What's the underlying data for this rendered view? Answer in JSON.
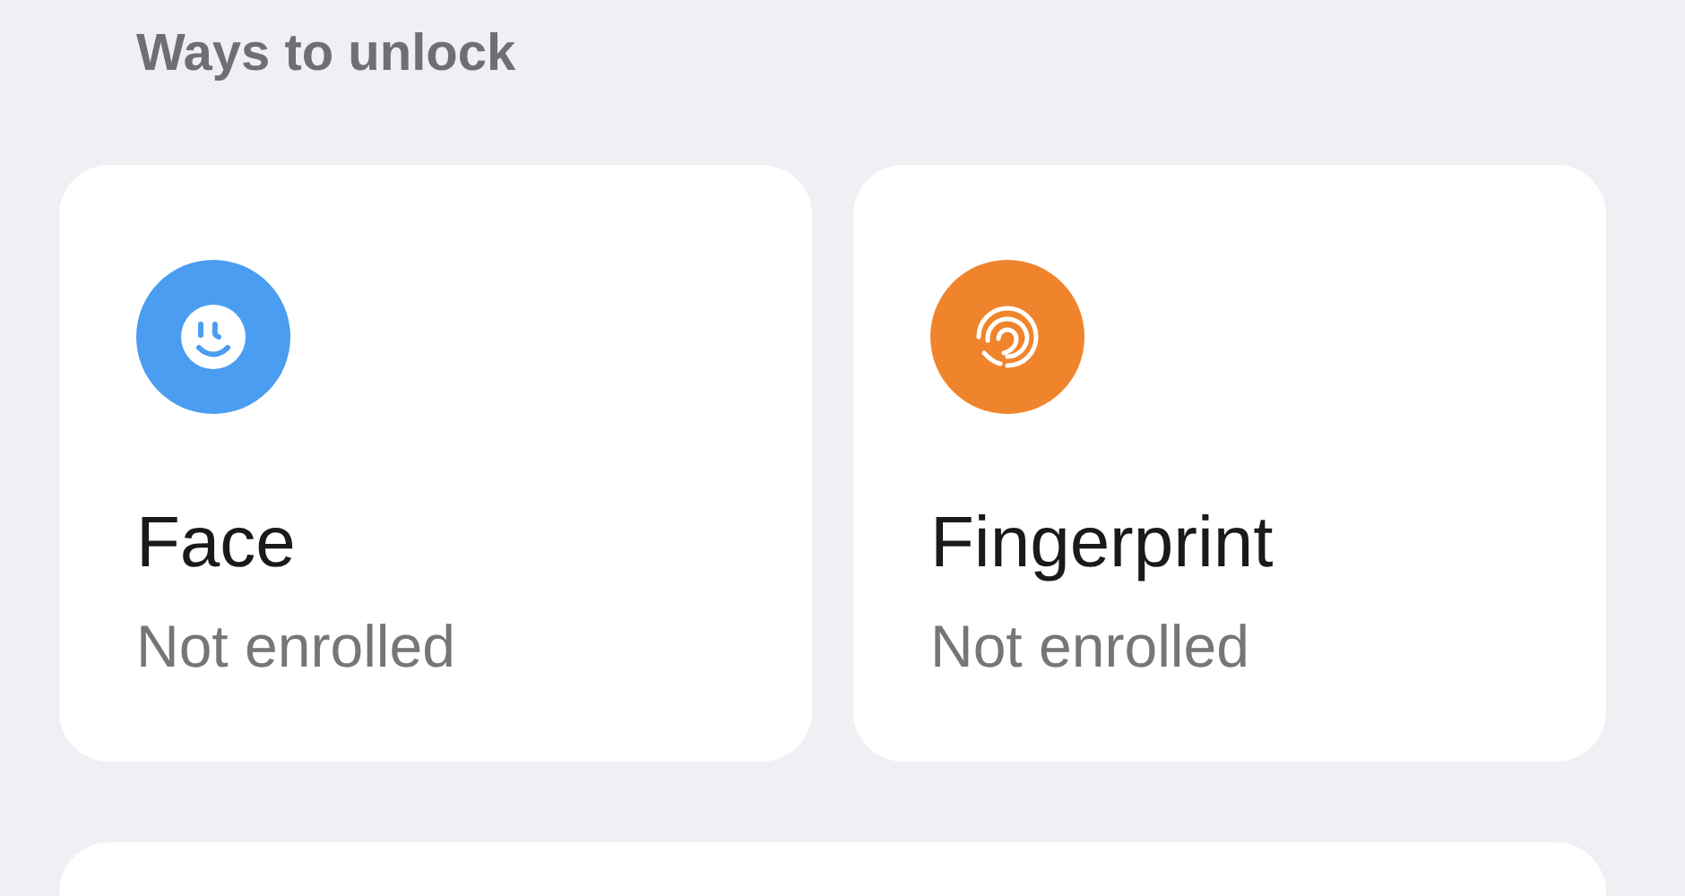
{
  "section_title": "Ways to unlock",
  "methods": [
    {
      "kind": "face",
      "title": "Face",
      "status": "Not enrolled",
      "color": "#4a9df0"
    },
    {
      "kind": "fingerprint",
      "title": "Fingerprint",
      "status": "Not enrolled",
      "color": "#f0842c"
    }
  ]
}
